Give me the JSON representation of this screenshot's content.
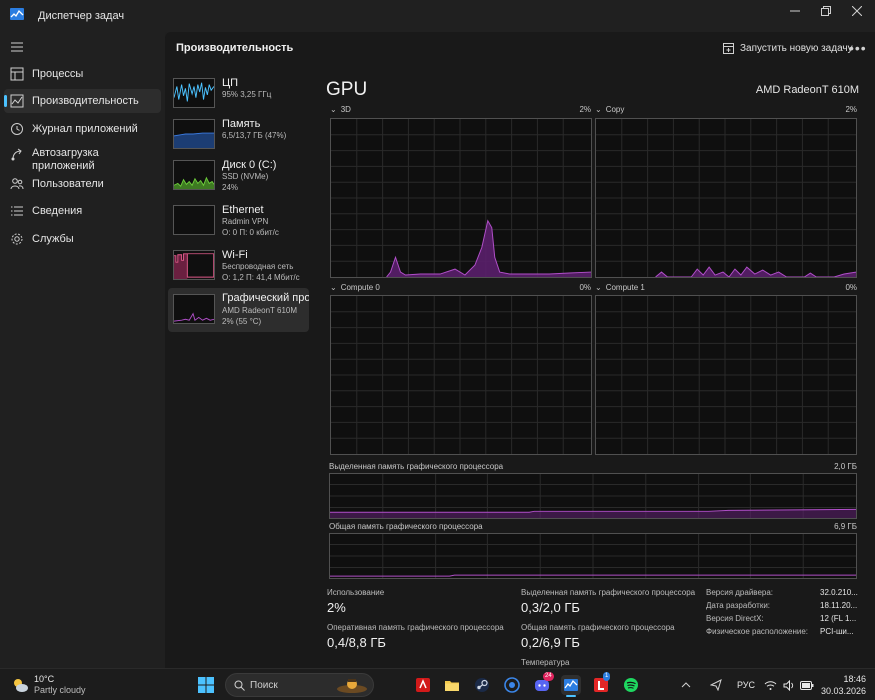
{
  "window": {
    "title": "Диспетчер задач",
    "minimize_icon": "minimize-icon",
    "maximize_icon": "maximize-icon",
    "close_icon": "close-icon"
  },
  "nav": {
    "items": [
      {
        "label": "Процессы",
        "icon": "processes-icon"
      },
      {
        "label": "Производительность",
        "icon": "performance-icon",
        "active": true
      },
      {
        "label": "Журнал приложений",
        "icon": "app-history-icon"
      },
      {
        "label": "Автозагрузка приложений",
        "icon": "startup-icon"
      },
      {
        "label": "Пользователи",
        "icon": "users-icon"
      },
      {
        "label": "Сведения",
        "icon": "details-icon"
      },
      {
        "label": "Службы",
        "icon": "services-icon"
      }
    ]
  },
  "header": {
    "title": "Производительность",
    "run_task_label": "Запустить новую задачу",
    "more_label": "•••"
  },
  "devices": [
    {
      "name": "ЦП",
      "sub1": "95% 3,25 ГГц",
      "sub2": "",
      "color": "#4cc2ff"
    },
    {
      "name": "Память",
      "sub1": "6,5/13,7 ГБ (47%)",
      "sub2": "",
      "color": "#3b7be0"
    },
    {
      "name": "Диск 0 (C:)",
      "sub1": "SSD (NVMe)",
      "sub2": "24%",
      "color": "#6ccc3a"
    },
    {
      "name": "Ethernet",
      "sub1": "Radmin VPN",
      "sub2": "О: 0 П: 0 кбит/с",
      "color": "#b55d5d"
    },
    {
      "name": "Wi-Fi",
      "sub1": "Беспроводная сеть",
      "sub2": "О: 1,2 П: 41,4 Мбит/с",
      "color": "#e05a8a"
    },
    {
      "name": "Графический процессор",
      "sub1": "AMD RadeonT 610M",
      "sub2": "2% (55 °C)",
      "color": "#b04fc8",
      "active": true
    }
  ],
  "gpu": {
    "title": "GPU",
    "model": "AMD RadeonT 610M",
    "accent": "#b04fc8",
    "engines": [
      {
        "name": "3D",
        "pct": "2%"
      },
      {
        "name": "Copy",
        "pct": "2%"
      },
      {
        "name": "Compute 0",
        "pct": "0%"
      },
      {
        "name": "Compute 1",
        "pct": "0%"
      }
    ],
    "dedicated_label": "Выделенная память графического процессора",
    "dedicated_max": "2,0 ГБ",
    "shared_label": "Общая память графического процессора",
    "shared_max": "6,9 ГБ"
  },
  "stats": {
    "usage_label": "Использование",
    "usage_value": "2%",
    "ram_label": "Оперативная память графического процессора",
    "ram_value": "0,4/8,8 ГБ",
    "dedicated_label": "Выделенная память графического процессора",
    "dedicated_value": "0,3/2,0 ГБ",
    "shared_label": "Общая память графического процессора",
    "shared_value": "0,2/6,9 ГБ",
    "temp_label": "Температура",
    "kv": [
      {
        "key": "Версия драйвера:",
        "value": "32.0.210..."
      },
      {
        "key": "Дата разработки:",
        "value": "18.11.20..."
      },
      {
        "key": "Версия DirectX:",
        "value": "12 (FL 1..."
      },
      {
        "key": "Физическое расположение:",
        "value": "PCI-ши..."
      }
    ]
  },
  "taskbar": {
    "weather_temp": "10°C",
    "weather_desc": "Partly cloudy",
    "search_placeholder": "Поиск",
    "discord_badge": "24",
    "lasso_badge": "1",
    "lang": "РУС",
    "time": "18:46",
    "date": "30.03.2026"
  }
}
